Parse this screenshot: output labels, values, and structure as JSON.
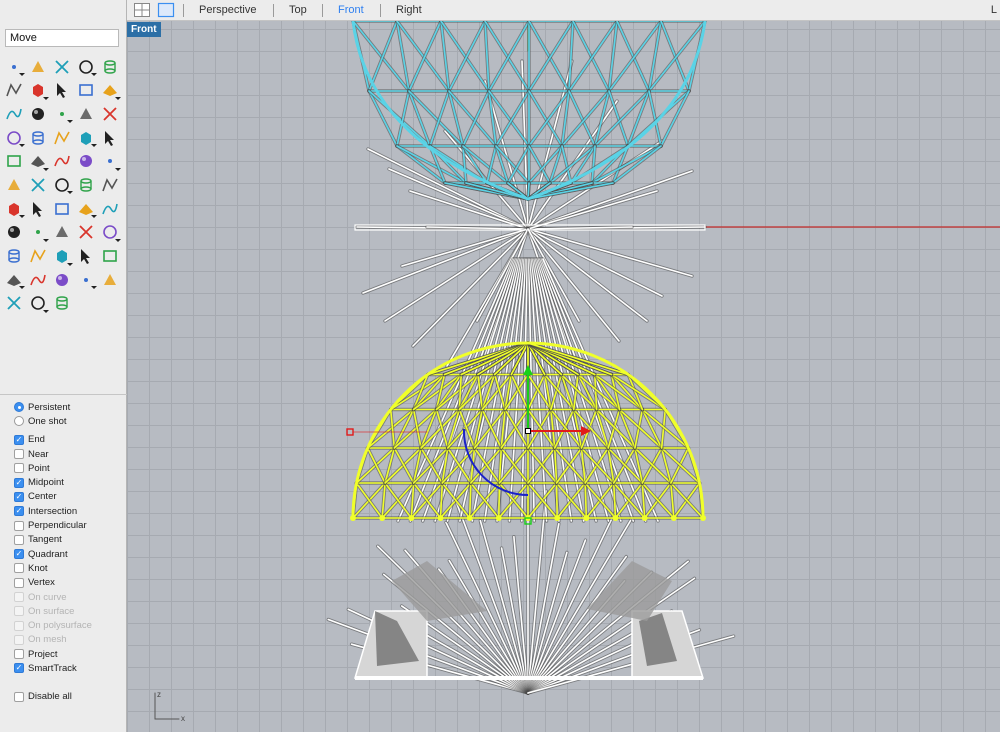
{
  "command": {
    "value": "Move"
  },
  "tabs": {
    "perspective": "Perspective",
    "top": "Top",
    "front": "Front",
    "right": "Right",
    "active": "Front",
    "right_edge_text": "L"
  },
  "viewport": {
    "label": "Front",
    "axis_x": "x",
    "axis_z": "z"
  },
  "osnap": {
    "persistent": "Persistent",
    "one_shot": "One shot",
    "mode": "Persistent",
    "items": [
      {
        "label": "End",
        "checked": true,
        "enabled": true
      },
      {
        "label": "Near",
        "checked": false,
        "enabled": true
      },
      {
        "label": "Point",
        "checked": false,
        "enabled": true
      },
      {
        "label": "Midpoint",
        "checked": true,
        "enabled": true
      },
      {
        "label": "Center",
        "checked": true,
        "enabled": true
      },
      {
        "label": "Intersection",
        "checked": true,
        "enabled": true
      },
      {
        "label": "Perpendicular",
        "checked": false,
        "enabled": true
      },
      {
        "label": "Tangent",
        "checked": false,
        "enabled": true
      },
      {
        "label": "Quadrant",
        "checked": true,
        "enabled": true
      },
      {
        "label": "Knot",
        "checked": false,
        "enabled": true
      },
      {
        "label": "Vertex",
        "checked": false,
        "enabled": true
      },
      {
        "label": "On curve",
        "checked": false,
        "enabled": false
      },
      {
        "label": "On surface",
        "checked": false,
        "enabled": false
      },
      {
        "label": "On polysurface",
        "checked": false,
        "enabled": false
      },
      {
        "label": "On mesh",
        "checked": false,
        "enabled": false
      },
      {
        "label": "Project",
        "checked": false,
        "enabled": true
      },
      {
        "label": "SmartTrack",
        "checked": true,
        "enabled": true
      }
    ],
    "disable_all": {
      "label": "Disable all",
      "checked": false
    }
  },
  "colors": {
    "selected_top": "#5ad3e6",
    "selected_dome": "#f0ff2a",
    "wire": "#ffffff",
    "x_axis": "#c22a2a",
    "y_axis": "#2a9a2a",
    "gumball_x": "#e11a1a",
    "gumball_y": "#18d018",
    "gumball_rot": "#1a22c8",
    "accent": "#2d7ff0"
  },
  "toolbar_icons": [
    "select-arrow-icon",
    "point-icon",
    "polyline-icon",
    "curve-icon",
    "circle-icon",
    "ellipse-icon",
    "arc-icon",
    "rectangle-icon",
    "polygon-icon",
    "fillet-curve-icon",
    "surface-corner-icon",
    "extrude-curve-icon",
    "box-icon",
    "sphere-icon",
    "cylinder-icon",
    "surface-patch-icon",
    "boolean-icon",
    "explode-icon",
    "trim-icon",
    "split-icon",
    "join-icon",
    "group-icon",
    "rebuild-icon",
    "offset-icon",
    "text-icon",
    "move-icon",
    "copy-icon",
    "rotate-icon",
    "scale-icon",
    "array-icon",
    "grid-array-icon",
    "fillet-edge-icon",
    "sweep-icon",
    "check-icon",
    "shell-icon",
    "dimension-icon",
    "analyze-icon",
    "zoom-select-icon",
    "zoom-window-icon",
    "zoom-icon",
    "pan-icon",
    "car-render-icon",
    "hide-icon",
    "show-icon",
    "light-icon",
    "lock-icon",
    "layer-icon",
    "color-wheel-icon",
    "properties-icon",
    "sun-icon",
    "material-sphere-icon",
    "rotate-view-icon",
    "transform-icon"
  ]
}
